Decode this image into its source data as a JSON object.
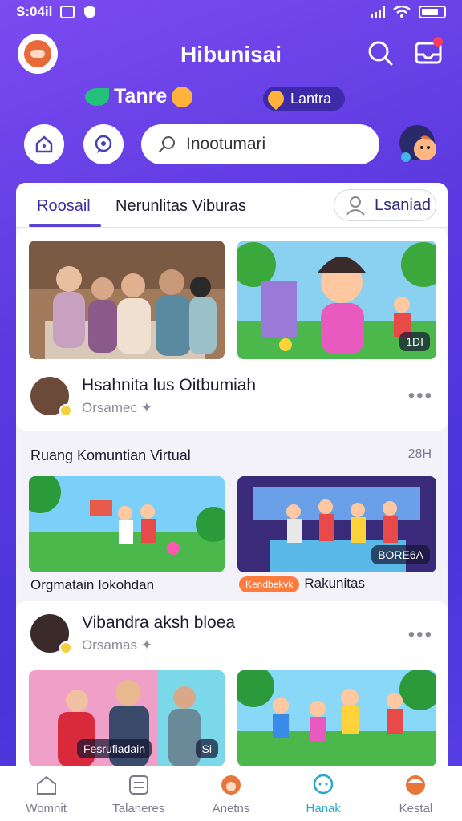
{
  "status_bar": {
    "time": "S:04il"
  },
  "header": {
    "title": "Hibunisai"
  },
  "chips": {
    "primary": "Tanre",
    "location": "Lantra"
  },
  "search": {
    "placeholder": "Inootumari"
  },
  "tabs": [
    {
      "label": "Roosail"
    },
    {
      "label": "Nerunlitas Viburas"
    }
  ],
  "tab_action": {
    "label": "Lsaniad"
  },
  "post1": {
    "badge": "1DI",
    "author_name": "Hsahnita lus Oitbumiah",
    "author_sub": "Orsamec"
  },
  "section": {
    "title": "Ruang Komuntian Virtual",
    "meta": "28H"
  },
  "section_thumbs": [
    {
      "caption": "Orgmatain Iokohdan"
    },
    {
      "badge": "BORE6A",
      "tag": "Kendbekvk",
      "caption": "Rakunitas"
    }
  ],
  "post2": {
    "author_name": "Vibandra aksh bloea",
    "author_sub": "Orsamas",
    "thumb_badges": [
      "Fesrufiadain",
      "Si"
    ]
  },
  "bottom_nav": [
    {
      "label": "Womnit"
    },
    {
      "label": "Talaneres"
    },
    {
      "label": "Anetns"
    },
    {
      "label": "Hanak"
    },
    {
      "label": "Kestal"
    }
  ],
  "colors": {
    "accent": "#5a44d6",
    "active_nav": "#2aa7c6",
    "bg_top": "#7b4bf0",
    "bg_bottom": "#4a34d8"
  }
}
